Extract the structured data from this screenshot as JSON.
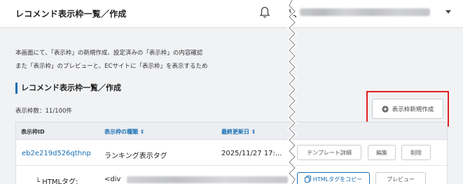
{
  "header": {
    "title": "レコメンド表示枠一覧／作成",
    "bell_icon": "bell-icon",
    "user_icon": "user-icon",
    "menu_caret_icon": "caret-down-icon"
  },
  "description": {
    "line1": "本画面にて、「表示枠」の新規作成、設定済みの「表示枠」の内容確認",
    "line2": "また「表示枠」のプレビューと、ECサイトに「表示枠」を表示するため"
  },
  "section": {
    "title": "レコメンド表示枠一覧／作成",
    "count_text": "表示枠数：11/100件",
    "create_button_label": "表示枠新規作成",
    "create_button_icon": "plus-circle-icon"
  },
  "table": {
    "headers": {
      "id": "表示枠ID",
      "type": "表示枠の種類 ⇕",
      "updated": "最終更新日 ⇕"
    },
    "rows": [
      {
        "id": "eb2e219d526qthnp",
        "type": "ランキング表示タグ",
        "updated": "2025/11/27 17:...",
        "detail_button": "テンプレート詳細",
        "edit_button": "編集",
        "delete_button": "削除",
        "html_label": "└ HTMLタグ:",
        "html_value": "<div",
        "copy_button": "HTMLタグをコピー",
        "preview_button": "プレビュー"
      }
    ]
  },
  "colors": {
    "accent": "#1a6fb5",
    "highlight": "#e02020",
    "background": "#f1f2f4"
  }
}
